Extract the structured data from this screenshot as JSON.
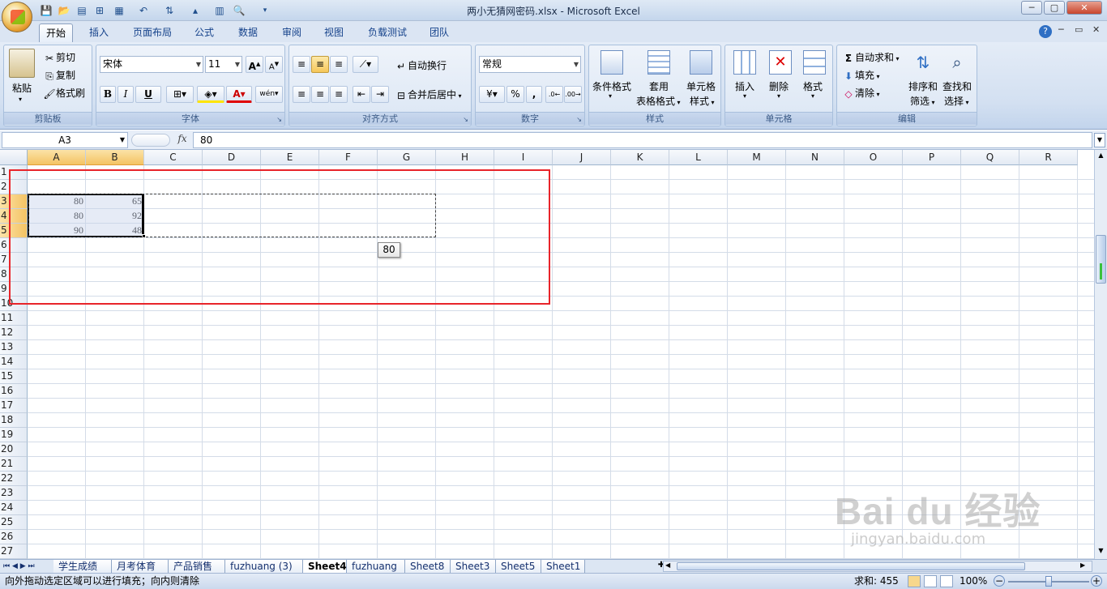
{
  "window": {
    "title": "两小无猜网密码.xlsx - Microsoft Excel",
    "minimize": "─",
    "maximize": "▢",
    "close": "✕"
  },
  "ribbon_tabs": [
    "开始",
    "插入",
    "页面布局",
    "公式",
    "数据",
    "审阅",
    "视图",
    "负载测试",
    "团队"
  ],
  "active_tab": "开始",
  "clipboard": {
    "paste": "粘贴",
    "cut": "剪切",
    "copy": "复制",
    "format_painter": "格式刷",
    "label": "剪贴板"
  },
  "font": {
    "name": "宋体",
    "size": "11",
    "bold": "B",
    "italic": "I",
    "underline": "U",
    "label": "字体",
    "phonetic": "wén"
  },
  "alignment": {
    "wrap": "自动换行",
    "merge": "合并后居中",
    "label": "对齐方式"
  },
  "number": {
    "format": "常规",
    "percent": "%",
    "comma": ",",
    "label": "数字"
  },
  "styles": {
    "conditional": "条件格式",
    "table_line1": "套用",
    "table_line2": "表格格式",
    "cell_line1": "单元格",
    "cell_line2": "样式",
    "label": "样式"
  },
  "cells": {
    "insert": "插入",
    "delete": "删除",
    "format": "格式",
    "label": "单元格"
  },
  "editing": {
    "autosum": "自动求和",
    "fill": "填充",
    "clear": "清除",
    "sort_line1": "排序和",
    "sort_line2": "筛选",
    "find_line1": "查找和",
    "find_line2": "选择",
    "label": "编辑"
  },
  "formula_bar": {
    "name_box": "A3",
    "fx": "fx",
    "value": "80"
  },
  "columns": [
    "A",
    "B",
    "C",
    "D",
    "E",
    "F",
    "G",
    "H",
    "I",
    "J",
    "K",
    "L",
    "M",
    "N",
    "O",
    "P",
    "Q",
    "R"
  ],
  "rows": [
    "1",
    "2",
    "3",
    "4",
    "5",
    "6",
    "7",
    "8",
    "9",
    "10",
    "11",
    "12",
    "13",
    "14",
    "15",
    "16",
    "17",
    "18",
    "19",
    "20",
    "21",
    "22",
    "23",
    "24",
    "25",
    "26",
    "27"
  ],
  "cells_data": [
    {
      "row": 3,
      "A": "80",
      "B": "65"
    },
    {
      "row": 4,
      "A": "80",
      "B": "92"
    },
    {
      "row": 5,
      "A": "90",
      "B": "48"
    }
  ],
  "drag_tooltip": "80",
  "sheet_tabs": [
    "学生成绩",
    "月考体育",
    "产品销售",
    "fuzhuang (3)",
    "Sheet4",
    "fuzhuang",
    "Sheet8",
    "Sheet3",
    "Sheet5",
    "Sheet1"
  ],
  "active_sheet": "Sheet4",
  "status": {
    "message": "向外拖动选定区域可以进行填充；向内则清除",
    "sum": "求和: 455",
    "zoom": "100%"
  },
  "watermark": {
    "brand": "Bai du 经验",
    "url": "jingyan.baidu.com"
  },
  "colors": {
    "annotation_red": "#e8242a",
    "selection_orange": "#f4c363",
    "ribbon_blue": "#d3e0f1"
  }
}
